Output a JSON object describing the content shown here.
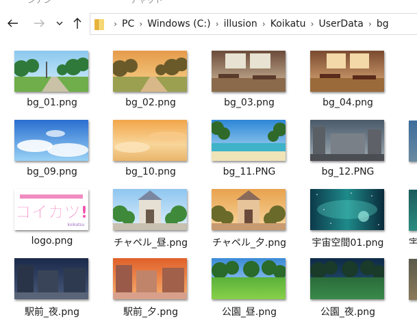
{
  "window": {
    "top_strip_fragments": [
      "シアン",
      "チャット"
    ]
  },
  "navigation": {
    "back_icon": "arrow-left-icon",
    "forward_icon": "arrow-right-icon",
    "recent_icon": "chevron-down-icon",
    "up_icon": "arrow-up-icon"
  },
  "address_bar": {
    "breadcrumbs": [
      "PC",
      "Windows (C:)",
      "illusion",
      "Koikatu",
      "UserData",
      "bg"
    ]
  },
  "files": [
    {
      "name": "bg_01.png",
      "scene": "park-day"
    },
    {
      "name": "bg_02.png",
      "scene": "park-sunset"
    },
    {
      "name": "bg_03.png",
      "scene": "cafe"
    },
    {
      "name": "bg_04.png",
      "scene": "cafe-warm"
    },
    {
      "name": "bg_09.png",
      "scene": "sky-blue"
    },
    {
      "name": "bg_10.png",
      "scene": "sky-sunset"
    },
    {
      "name": "bg_11.PNG",
      "scene": "beach"
    },
    {
      "name": "bg_12.PNG",
      "scene": "ruins"
    },
    {
      "name": "logo.png",
      "scene": "logo",
      "logo_text": "コイカツ!",
      "logo_small_text": "koikatsu"
    },
    {
      "name": "チャペル_昼.png",
      "scene": "chapel-day"
    },
    {
      "name": "チャペル_夕.png",
      "scene": "chapel-sunset"
    },
    {
      "name": "宇宙空間01.png",
      "scene": "space"
    },
    {
      "name": "駅前_夜.png",
      "scene": "street-night"
    },
    {
      "name": "駅前_夕.png",
      "scene": "street-sunset"
    },
    {
      "name": "公園_昼.png",
      "scene": "lawn-day"
    },
    {
      "name": "公園_夜.png",
      "scene": "lawn-night"
    }
  ],
  "partial_column": {
    "label_fragment": "宇"
  }
}
